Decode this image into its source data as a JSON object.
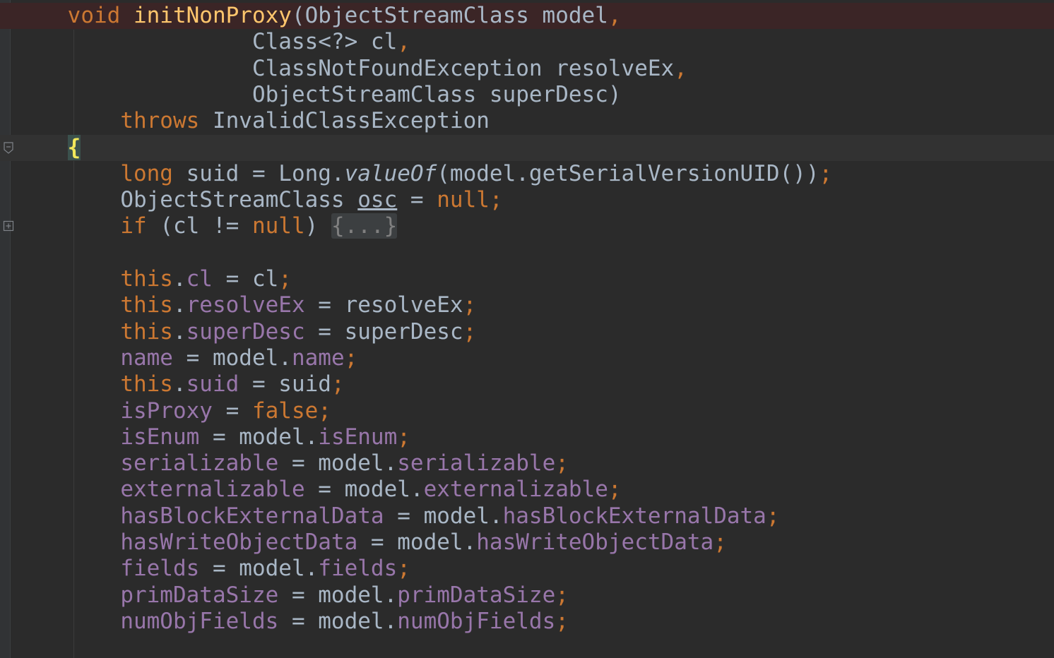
{
  "editor": {
    "lines": [
      {
        "indent": "    ",
        "tokens": [
          {
            "t": "void ",
            "c": "kw"
          },
          {
            "t": "initNonProxy",
            "c": "fn"
          },
          {
            "t": "(ObjectStreamClass model",
            "c": ""
          },
          {
            "t": ",",
            "c": "kw"
          }
        ]
      },
      {
        "indent": "                  ",
        "tokens": [
          {
            "t": "Class<?> cl",
            "c": ""
          },
          {
            "t": ",",
            "c": "kw"
          }
        ]
      },
      {
        "indent": "                  ",
        "tokens": [
          {
            "t": "ClassNotFoundException resolveEx",
            "c": ""
          },
          {
            "t": ",",
            "c": "kw"
          }
        ]
      },
      {
        "indent": "                  ",
        "tokens": [
          {
            "t": "ObjectStreamClass superDesc)",
            "c": ""
          }
        ]
      },
      {
        "indent": "        ",
        "tokens": [
          {
            "t": "throws ",
            "c": "kw"
          },
          {
            "t": "InvalidClassException",
            "c": ""
          }
        ]
      },
      {
        "indent": "    ",
        "tokens": [
          {
            "t": "{",
            "c": "brace"
          }
        ]
      },
      {
        "indent": "        ",
        "tokens": [
          {
            "t": "long ",
            "c": "kw"
          },
          {
            "t": "suid = Long.",
            "c": ""
          },
          {
            "t": "valueOf",
            "c": "italic"
          },
          {
            "t": "(model.getSerialVersionUID())",
            "c": ""
          },
          {
            "t": ";",
            "c": "kw"
          }
        ]
      },
      {
        "indent": "        ",
        "tokens": [
          {
            "t": "ObjectStreamClass ",
            "c": ""
          },
          {
            "t": "osc",
            "c": "ul"
          },
          {
            "t": " = ",
            "c": ""
          },
          {
            "t": "null;",
            "c": "kw"
          }
        ]
      },
      {
        "indent": "        ",
        "tokens": [
          {
            "t": "if ",
            "c": "kw"
          },
          {
            "t": "(cl != ",
            "c": ""
          },
          {
            "t": "null",
            "c": "kw"
          },
          {
            "t": ") ",
            "c": ""
          },
          {
            "t": "{...}",
            "c": "fold"
          }
        ]
      },
      {
        "indent": "",
        "tokens": []
      },
      {
        "indent": "        ",
        "tokens": [
          {
            "t": "this",
            "c": "kw"
          },
          {
            "t": ".",
            "c": ""
          },
          {
            "t": "cl",
            "c": "field"
          },
          {
            "t": " = cl",
            "c": ""
          },
          {
            "t": ";",
            "c": "kw"
          }
        ]
      },
      {
        "indent": "        ",
        "tokens": [
          {
            "t": "this",
            "c": "kw"
          },
          {
            "t": ".",
            "c": ""
          },
          {
            "t": "resolveEx",
            "c": "field"
          },
          {
            "t": " = resolveEx",
            "c": ""
          },
          {
            "t": ";",
            "c": "kw"
          }
        ]
      },
      {
        "indent": "        ",
        "tokens": [
          {
            "t": "this",
            "c": "kw"
          },
          {
            "t": ".",
            "c": ""
          },
          {
            "t": "superDesc",
            "c": "field"
          },
          {
            "t": " = superDesc",
            "c": ""
          },
          {
            "t": ";",
            "c": "kw"
          }
        ]
      },
      {
        "indent": "        ",
        "tokens": [
          {
            "t": "name",
            "c": "field"
          },
          {
            "t": " = model.",
            "c": ""
          },
          {
            "t": "name",
            "c": "field"
          },
          {
            "t": ";",
            "c": "kw"
          }
        ]
      },
      {
        "indent": "        ",
        "tokens": [
          {
            "t": "this",
            "c": "kw"
          },
          {
            "t": ".",
            "c": ""
          },
          {
            "t": "suid",
            "c": "field"
          },
          {
            "t": " = suid",
            "c": ""
          },
          {
            "t": ";",
            "c": "kw"
          }
        ]
      },
      {
        "indent": "        ",
        "tokens": [
          {
            "t": "isProxy",
            "c": "field"
          },
          {
            "t": " = ",
            "c": ""
          },
          {
            "t": "false;",
            "c": "kw"
          }
        ]
      },
      {
        "indent": "        ",
        "tokens": [
          {
            "t": "isEnum",
            "c": "field"
          },
          {
            "t": " = model.",
            "c": ""
          },
          {
            "t": "isEnum",
            "c": "field"
          },
          {
            "t": ";",
            "c": "kw"
          }
        ]
      },
      {
        "indent": "        ",
        "tokens": [
          {
            "t": "serializable",
            "c": "field"
          },
          {
            "t": " = model.",
            "c": ""
          },
          {
            "t": "serializable",
            "c": "field"
          },
          {
            "t": ";",
            "c": "kw"
          }
        ]
      },
      {
        "indent": "        ",
        "tokens": [
          {
            "t": "externalizable",
            "c": "field"
          },
          {
            "t": " = model.",
            "c": ""
          },
          {
            "t": "externalizable",
            "c": "field"
          },
          {
            "t": ";",
            "c": "kw"
          }
        ]
      },
      {
        "indent": "        ",
        "tokens": [
          {
            "t": "hasBlockExternalData",
            "c": "field"
          },
          {
            "t": " = model.",
            "c": ""
          },
          {
            "t": "hasBlockExternalData",
            "c": "field"
          },
          {
            "t": ";",
            "c": "kw"
          }
        ]
      },
      {
        "indent": "        ",
        "tokens": [
          {
            "t": "hasWriteObjectData",
            "c": "field"
          },
          {
            "t": " = model.",
            "c": ""
          },
          {
            "t": "hasWriteObjectData",
            "c": "field"
          },
          {
            "t": ";",
            "c": "kw"
          }
        ]
      },
      {
        "indent": "        ",
        "tokens": [
          {
            "t": "fields",
            "c": "field"
          },
          {
            "t": " = model.",
            "c": ""
          },
          {
            "t": "fields",
            "c": "field"
          },
          {
            "t": ";",
            "c": "kw"
          }
        ]
      },
      {
        "indent": "        ",
        "tokens": [
          {
            "t": "primDataSize",
            "c": "field"
          },
          {
            "t": " = model.",
            "c": ""
          },
          {
            "t": "primDataSize",
            "c": "field"
          },
          {
            "t": ";",
            "c": "kw"
          }
        ]
      },
      {
        "indent": "        ",
        "tokens": [
          {
            "t": "numObjFields",
            "c": "field"
          },
          {
            "t": " = model.",
            "c": ""
          },
          {
            "t": "numObjFields",
            "c": "field"
          },
          {
            "t": ";",
            "c": "kw"
          }
        ]
      }
    ],
    "gutter_icons": [
      {
        "name": "fold-collapse-icon",
        "line": 5
      },
      {
        "name": "fold-expand-icon",
        "line": 8
      }
    ],
    "colors": {
      "background": "#2b2b2b",
      "keyword": "#cc7832",
      "method": "#ffc66d",
      "field": "#9876aa",
      "text": "#a9b7c6",
      "error_line_bg": "#3b2526"
    }
  }
}
